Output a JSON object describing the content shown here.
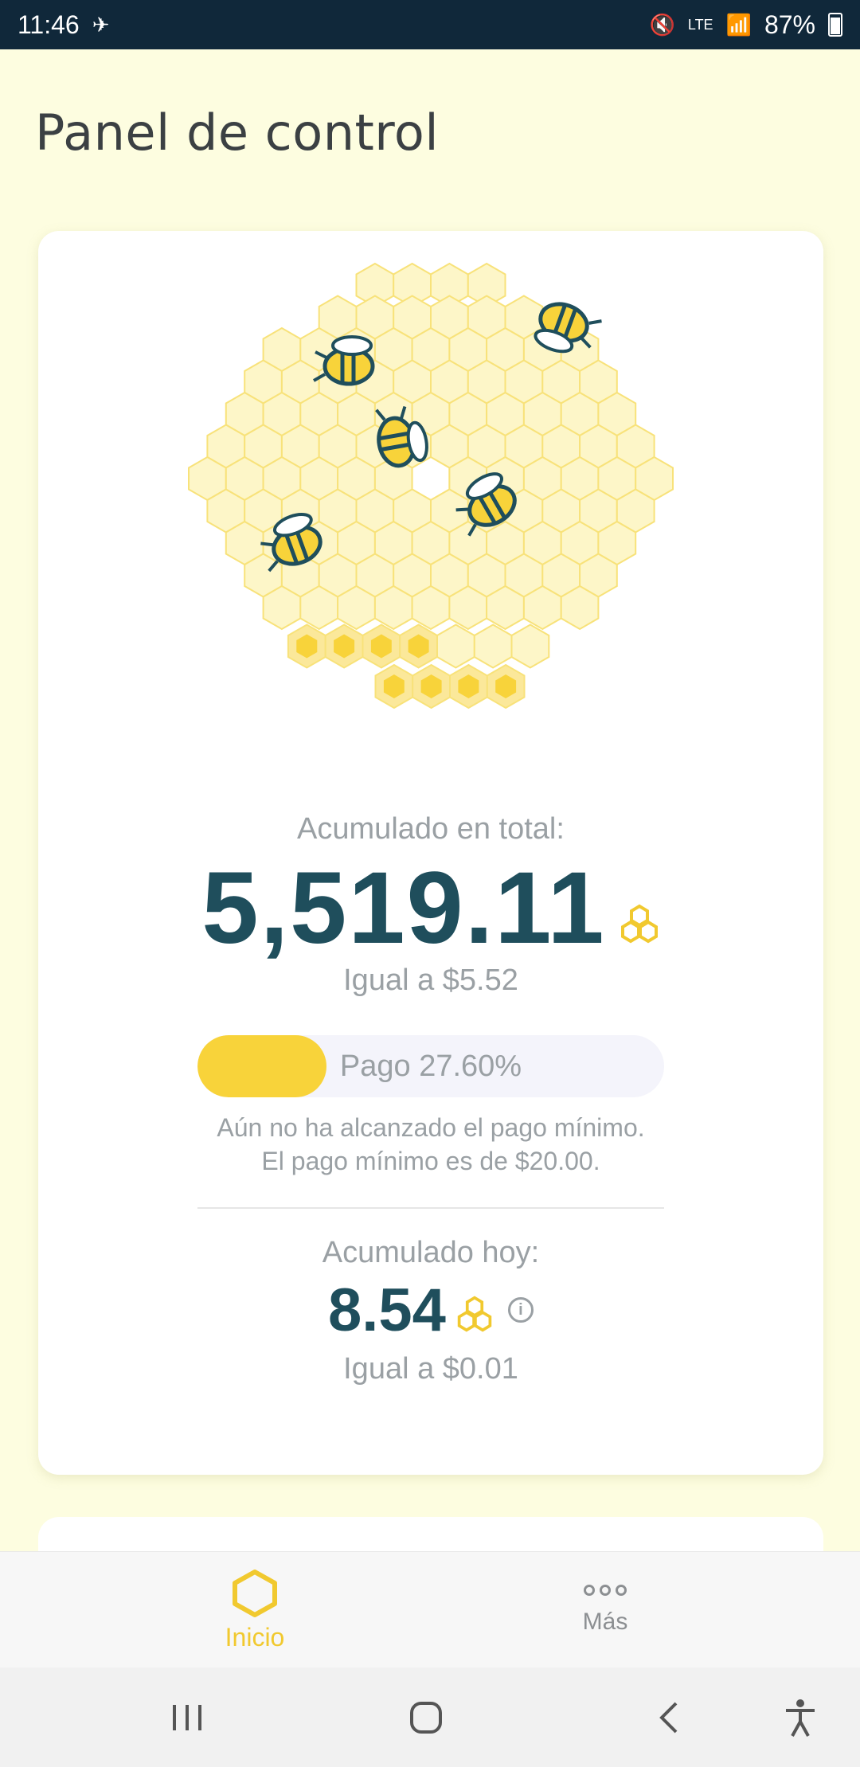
{
  "status_bar": {
    "time": "11:46",
    "notification_icon": "bee-notify-icon",
    "battery": "87%"
  },
  "page": {
    "title": "Panel de control"
  },
  "summary": {
    "total_label": "Acumulado en total:",
    "total_value": "5,519.11",
    "total_equal": "Igual a $5.52",
    "payout_label": "Pago 27.60%",
    "payout_percent": 27.6,
    "minimum_note_1": "Aún no ha alcanzado el pago mínimo.",
    "minimum_note_2": "El pago mínimo es de $20.00.",
    "today_label": "Acumulado hoy:",
    "today_value": "8.54",
    "today_equal": "Igual a $0.01"
  },
  "bottom_nav": {
    "items": [
      {
        "label": "Inicio",
        "icon": "hexagon-icon",
        "active": true
      },
      {
        "label": "Más",
        "icon": "more-dots-icon",
        "active": false
      }
    ]
  },
  "colors": {
    "accent": "#f8d33a",
    "value_text": "#1f4e5c",
    "background": "#fdfde0"
  }
}
